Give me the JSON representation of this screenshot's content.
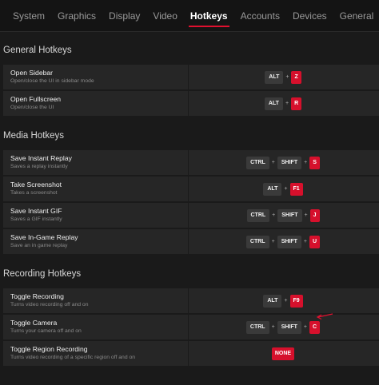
{
  "nav": {
    "tabs": [
      {
        "label": "System",
        "active": false
      },
      {
        "label": "Graphics",
        "active": false
      },
      {
        "label": "Display",
        "active": false
      },
      {
        "label": "Video",
        "active": false
      },
      {
        "label": "Hotkeys",
        "active": true
      },
      {
        "label": "Accounts",
        "active": false
      },
      {
        "label": "Devices",
        "active": false
      },
      {
        "label": "General",
        "active": false
      }
    ]
  },
  "sections": [
    {
      "title": "General Hotkeys",
      "rows": [
        {
          "name": "Open Sidebar",
          "desc": "Open/close the UI in sidebar mode",
          "keys": [
            "ALT",
            "Z"
          ]
        },
        {
          "name": "Open Fullscreen",
          "desc": "Open/close the UI",
          "keys": [
            "ALT",
            "R"
          ]
        }
      ]
    },
    {
      "title": "Media Hotkeys",
      "rows": [
        {
          "name": "Save Instant Replay",
          "desc": "Saves a replay instantly",
          "keys": [
            "CTRL",
            "SHIFT",
            "S"
          ]
        },
        {
          "name": "Take Screenshot",
          "desc": "Takes a screenshot",
          "keys": [
            "ALT",
            "F1"
          ]
        },
        {
          "name": "Save Instant GIF",
          "desc": "Saves a GIF instantly",
          "keys": [
            "CTRL",
            "SHIFT",
            "J"
          ]
        },
        {
          "name": "Save In-Game Replay",
          "desc": "Save an in game replay",
          "keys": [
            "CTRL",
            "SHIFT",
            "U"
          ]
        }
      ]
    },
    {
      "title": "Recording Hotkeys",
      "rows": [
        {
          "name": "Toggle Recording",
          "desc": "Turns video recording off and on",
          "keys": [
            "ALT",
            "F9"
          ]
        },
        {
          "name": "Toggle Camera",
          "desc": "Turns your camera off and on",
          "keys": [
            "CTRL",
            "SHIFT",
            "C"
          ]
        },
        {
          "name": "Toggle Region Recording",
          "desc": "Turns video recording of a specific region off and on",
          "keys": [
            "NONE"
          ]
        }
      ]
    }
  ],
  "plus_sign": "+",
  "colors": {
    "accent": "#e1102f",
    "key_red": "#d6102c",
    "key_gray": "#3a3a3a",
    "row_bg": "#262626"
  },
  "annotation": {
    "icon": "red-arrow-icon",
    "points_to": "Toggle Recording F9"
  }
}
